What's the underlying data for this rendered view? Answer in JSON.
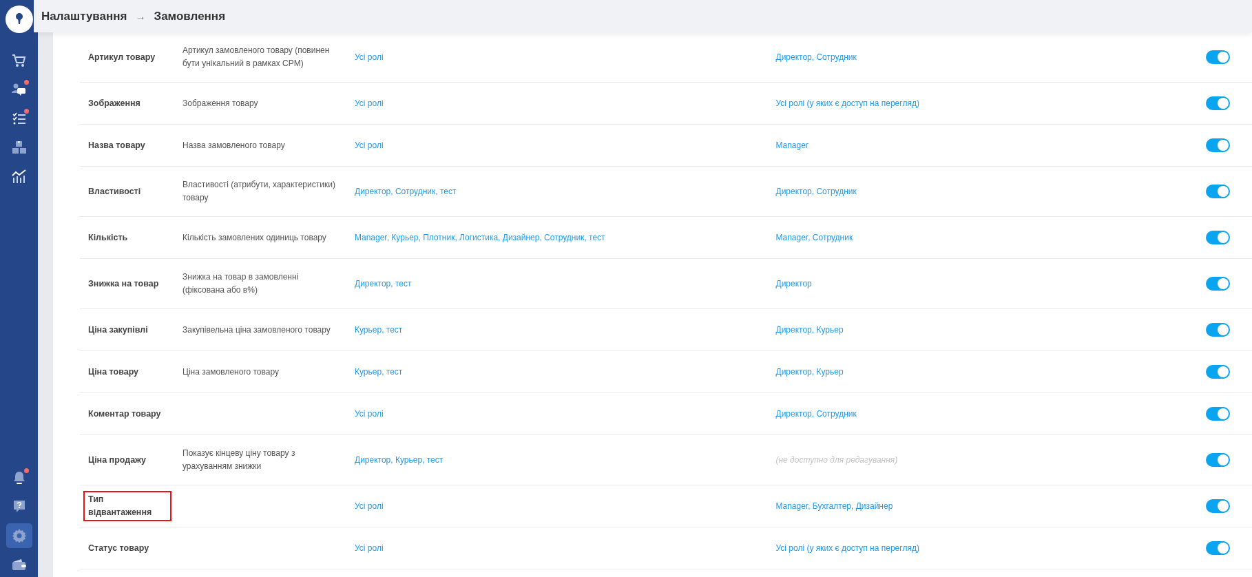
{
  "sidebar": {
    "top_items": [
      {
        "selected": false,
        "badge": false
      },
      {
        "selected": false,
        "badge": true
      },
      {
        "selected": false,
        "badge": true
      },
      {
        "selected": false,
        "badge": false
      },
      {
        "selected": false,
        "badge": false
      }
    ],
    "bottom_items": [
      {
        "selected": false,
        "badge": true
      },
      {
        "selected": false,
        "badge": false
      },
      {
        "selected": true,
        "badge": false
      },
      {
        "selected": false,
        "badge": false
      }
    ]
  },
  "breadcrumb": {
    "parent": "Налаштування",
    "separator": "→",
    "current": "Замовлення"
  },
  "rows": [
    {
      "name": "Артикул товару",
      "description": "Артикул замовленого товару (повинен бути унікальний в рамках CPM)",
      "edit_roles": "Усі ролі",
      "view_roles": "Директор, Сотрудник",
      "view_disabled": false,
      "on": true,
      "highlighted": false
    },
    {
      "name": "Зображення",
      "description": "Зображення товару",
      "edit_roles": "Усі ролі",
      "view_roles": "Усі ролі (у яких є доступ на перегляд)",
      "view_disabled": false,
      "on": true,
      "highlighted": false
    },
    {
      "name": "Назва товару",
      "description": "Назва замовленого товару",
      "edit_roles": "Усі ролі",
      "view_roles": "Manager",
      "view_disabled": false,
      "on": true,
      "highlighted": false
    },
    {
      "name": "Властивості",
      "description": "Властивості (атрибути, характеристики) товару",
      "edit_roles": "Директор, Сотрудник, тест",
      "view_roles": "Директор, Сотрудник",
      "view_disabled": false,
      "on": true,
      "highlighted": false
    },
    {
      "name": "Кількість",
      "description": "Кількість замовлених одиниць товару",
      "edit_roles": "Manager, Курьер, Плотник, Логистика, Дизайнер, Сотрудник, тест",
      "view_roles": "Manager, Сотрудник",
      "view_disabled": false,
      "on": true,
      "highlighted": false
    },
    {
      "name": "Знижка на товар",
      "description": "Знижка на товар в замовленні (фіксована або в%)",
      "edit_roles": "Директор, тест",
      "view_roles": "Директор",
      "view_disabled": false,
      "on": true,
      "highlighted": false
    },
    {
      "name": "Ціна закупівлі",
      "description": "Закупівельна ціна замовленого товару",
      "edit_roles": "Курьер, тест",
      "view_roles": "Директор, Курьер",
      "view_disabled": false,
      "on": true,
      "highlighted": false
    },
    {
      "name": "Ціна товару",
      "description": "Ціна замовленого товару",
      "edit_roles": "Курьер, тест",
      "view_roles": "Директор, Курьер",
      "view_disabled": false,
      "on": true,
      "highlighted": false
    },
    {
      "name": "Коментар товару",
      "edit_roles": "Усі ролі",
      "view_roles": "Директор, Сотрудник",
      "view_disabled": false,
      "on": true,
      "highlighted": false
    },
    {
      "name": "Ціна продажу",
      "description": "Показує кінцеву ціну товару з урахуванням знижки",
      "edit_roles": "Директор, Курьер, тест",
      "view_roles": "(не доступно для редагування)",
      "view_disabled": true,
      "on": true,
      "highlighted": false
    },
    {
      "name": "Тип відвантаження",
      "edit_roles": "Усі ролі",
      "view_roles": "Manager, Бухгалтер, Дизайнер",
      "view_disabled": false,
      "on": true,
      "highlighted": true
    },
    {
      "name": "Статус товару",
      "edit_roles": "Усі ролі",
      "view_roles": "Усі ролі (у яких є доступ на перегляд)",
      "view_disabled": false,
      "on": true,
      "highlighted": false
    }
  ]
}
